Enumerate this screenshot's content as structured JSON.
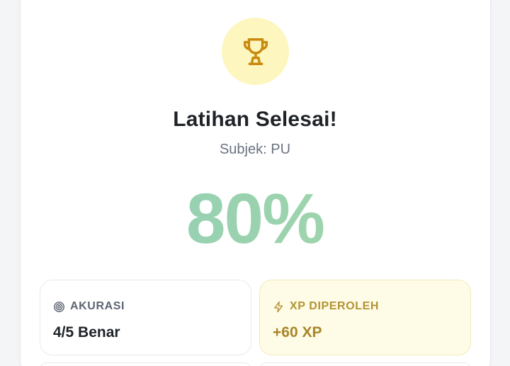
{
  "result": {
    "title": "Latihan Selesai!",
    "subtitle": "Subjek: PU",
    "score": "80%",
    "icon": "trophy-icon"
  },
  "stats": {
    "accuracy": {
      "label": "AKURASI",
      "value": "4/5 Benar",
      "icon": "target-icon"
    },
    "xp": {
      "label": "XP DIPEROLEH",
      "value": "+60 XP",
      "icon": "lightning-icon"
    }
  },
  "colors": {
    "trophy_bg": "#fdf6bf",
    "trophy_icon": "#c98a0e",
    "score_gradient_start": "#8fcdb8",
    "score_gradient_end": "#a6d8a6",
    "xp_card_bg": "#fefbe6",
    "xp_text": "#a8862a"
  }
}
